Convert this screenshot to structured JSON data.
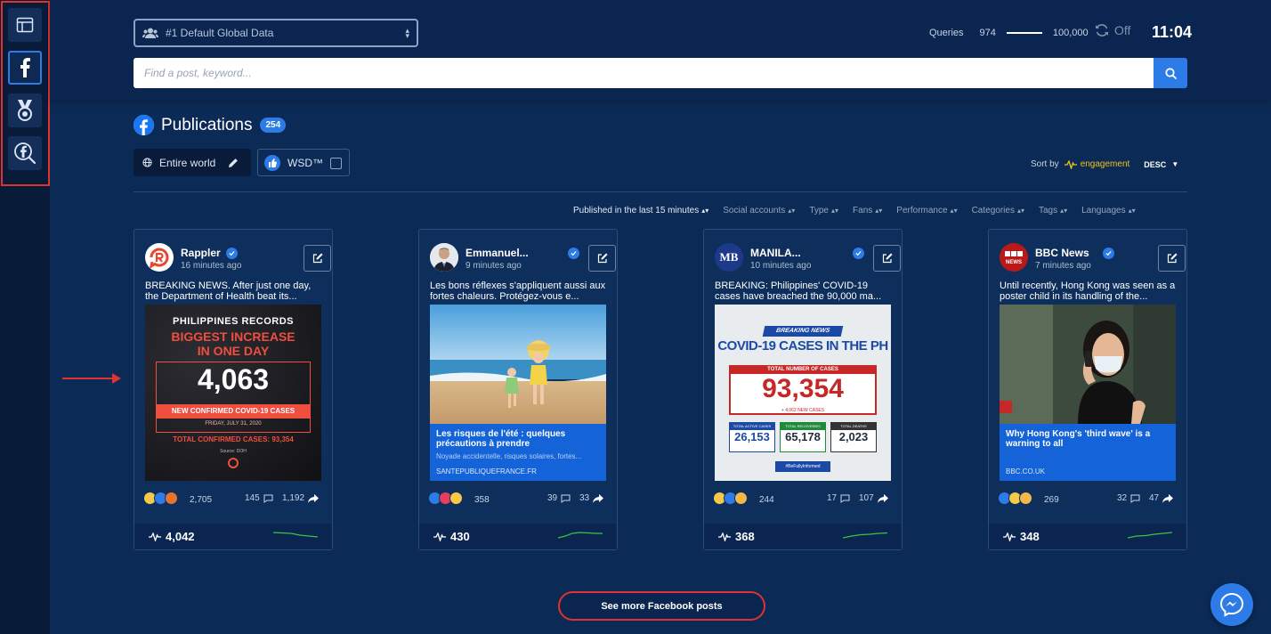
{
  "header": {
    "account_select": "#1 Default Global Data",
    "queries_label": "Queries",
    "queries_used": "974",
    "queries_total": "100,000",
    "sync_state": "Off",
    "clock": "11:04"
  },
  "search": {
    "placeholder": "Find a post, keyword..."
  },
  "publications": {
    "title": "Publications",
    "count": "254",
    "world_filter": "Entire world",
    "wsd_label": "WSD™",
    "sort_by_label": "Sort by",
    "sort_field": "engagement",
    "sort_order": "DESC",
    "filters": [
      "Published in the last 15 minutes",
      "Social accounts",
      "Type",
      "Fans",
      "Performance",
      "Categories",
      "Tags",
      "Languages"
    ]
  },
  "posts": [
    {
      "name": "Rappler",
      "time": "16 minutes ago",
      "text": "BREAKING NEWS. After just one day, the Department of Health beat its...",
      "image": {
        "heading1": "PHILIPPINES RECORDS",
        "heading2": "BIGGEST INCREASE",
        "heading3": "IN ONE DAY",
        "number": "4,063",
        "ribbon": "NEW CONFIRMED COVID-19 CASES",
        "date": "FRIDAY, JULY 31, 2020",
        "total": "TOTAL CONFIRMED CASES: 93,354",
        "source": "Source: DOH"
      },
      "reactions": "2,705",
      "comments": "145",
      "shares": "1,192",
      "score": "4,042"
    },
    {
      "name": "Emmanuel...",
      "time": "9 minutes ago",
      "text": "Les bons réflexes s'appliquent aussi aux fortes chaleurs. Protégez-vous e...",
      "link": {
        "title": "Les risques de l'été : quelques précautions à prendre",
        "desc": "Noyade accidentelle, risques solaires, fortes...",
        "url": "SANTEPUBLIQUEFRANCE.FR"
      },
      "reactions": "358",
      "comments": "39",
      "shares": "33",
      "score": "430"
    },
    {
      "name": "MANILA...",
      "time": "10 minutes ago",
      "text": "BREAKING: Philippines' COVID-19 cases have breached the 90,000 ma...",
      "image": {
        "tag": "BREAKING NEWS",
        "heading": "COVID-19 CASES IN THE PH",
        "total_label": "TOTAL NUMBER OF CASES",
        "number": "93,354",
        "new_cases": "+ 4,063 NEW CASES",
        "active": "26,153",
        "recovered": "65,178",
        "deaths": "2,023",
        "active_label": "TOTAL ACTIVE CASES",
        "recovered_label": "TOTAL RECOVERIES",
        "deaths_label": "TOTAL DEATHS",
        "hashtag": "#BeFullyInformed"
      },
      "reactions": "244",
      "comments": "17",
      "shares": "107",
      "score": "368"
    },
    {
      "name": "BBC News",
      "time": "7 minutes ago",
      "text": "Until recently, Hong Kong was seen as a poster child in its handling of the...",
      "link": {
        "title": "Why Hong Kong's 'third wave' is a warning to all",
        "url": "BBC.CO.UK"
      },
      "reactions": "269",
      "comments": "32",
      "shares": "47",
      "score": "348"
    }
  ],
  "see_more": "See more Facebook posts",
  "colors": {
    "accent": "#2d7be6",
    "highlight": "#e0322e",
    "engagement": "#f0c419",
    "spark": "#3ec43e"
  }
}
